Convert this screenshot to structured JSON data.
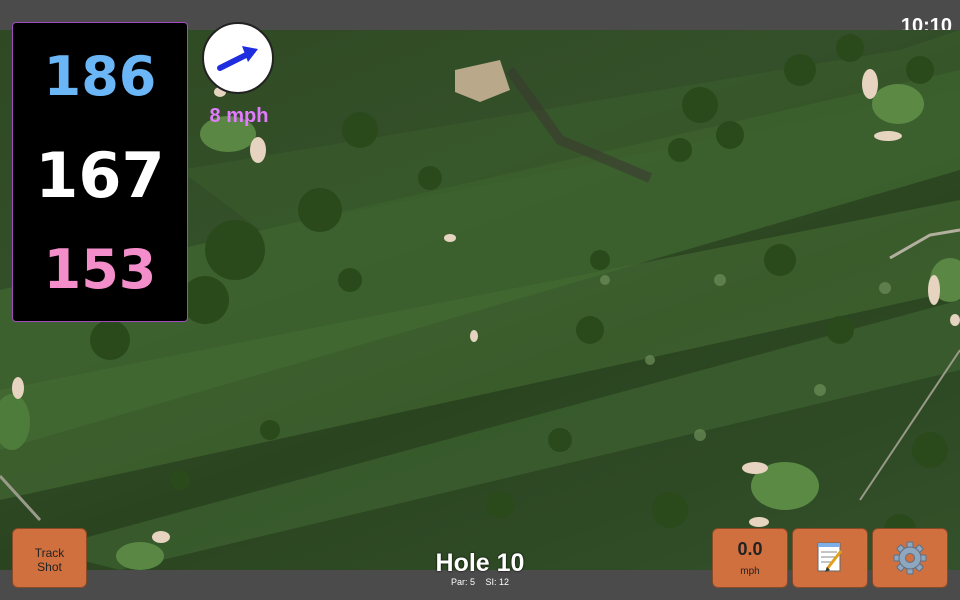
{
  "status": {
    "time": "10:10"
  },
  "distances": {
    "back": "186",
    "middle": "167",
    "front": "153"
  },
  "wind": {
    "speed": "8 mph",
    "icon": "wind-arrow-icon"
  },
  "buttons": {
    "track_shot": "Track Shot",
    "speed_value": "0.0",
    "speed_unit": "mph",
    "notes_icon": "notepad-icon",
    "settings_icon": "gear-icon"
  },
  "hole": {
    "title": "Hole 10",
    "par": "Par: 5",
    "si": "SI: 12"
  },
  "colors": {
    "back": "#6bb6f6",
    "middle": "#ffffff",
    "front": "#f48ecb",
    "wind_text": "#e37bff",
    "button": "#d0703f"
  }
}
